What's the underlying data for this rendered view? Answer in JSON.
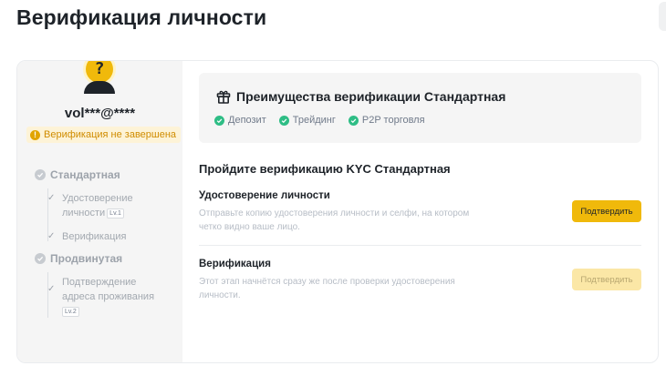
{
  "page": {
    "title": "Верификация личности"
  },
  "sidebar": {
    "username": "vol***@****",
    "status_badge": "Верификация не завершена",
    "levels": [
      {
        "label": "Стандартная",
        "items": [
          {
            "label_line1": "Удостоверение",
            "label_line2": "личности",
            "tag": "Lv.1"
          },
          {
            "label_line1": "Верификация",
            "label_line2": "",
            "tag": ""
          }
        ]
      },
      {
        "label": "Продвинутая",
        "items": [
          {
            "label_line1": "Подтверждение",
            "label_line2": "адреса проживания",
            "tag": "Lv.2"
          }
        ]
      }
    ]
  },
  "benefits": {
    "title": "Преимущества верификации Стандартная",
    "items": [
      "Депозит",
      "Трейдинг",
      "P2P торговля"
    ]
  },
  "kyc": {
    "heading": "Пройдите верификацию KYC Стандартная",
    "steps": [
      {
        "title": "Удостоверение личности",
        "desc_line1": "Отправьте копию удостоверения личности и селфи, на котором",
        "desc_line2": "четко видно ваше лицо.",
        "button": "Подтвердить",
        "button_enabled": true
      },
      {
        "title": "Верификация",
        "desc_line1": "Этот этап начнётся сразу же после проверки удостоверения",
        "desc_line2": "личности.",
        "button": "Подтвердить",
        "button_enabled": false
      }
    ]
  },
  "colors": {
    "accent": "#f0b90b",
    "warning_text": "#d08c00",
    "success": "#2ebd85",
    "sidebar_bg": "#f5f5f5"
  }
}
